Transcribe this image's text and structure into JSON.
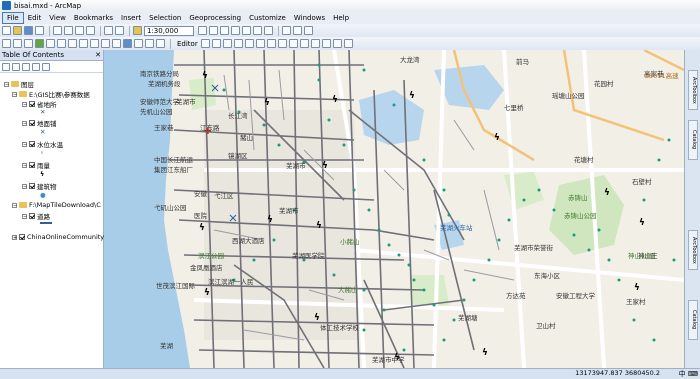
{
  "window": {
    "title": "bisai.mxd - ArcMap"
  },
  "menu": [
    "File",
    "Edit",
    "View",
    "Bookmarks",
    "Insert",
    "Selection",
    "Geoprocessing",
    "Customize",
    "Windows",
    "Help"
  ],
  "toolbar": {
    "scale": "1:30,000",
    "editor_label": "Editor"
  },
  "toc": {
    "title": "Table Of Contents",
    "layers": [
      {
        "label": "图层"
      },
      {
        "label": "E:\\GIS比赛\\参赛数据"
      },
      {
        "label": "省地所"
      },
      {
        "label": "地面铺"
      },
      {
        "label": "水位水温"
      },
      {
        "label": "雨量"
      },
      {
        "label": "建筑物"
      },
      {
        "label": "F:\\MapTileDownload\\C"
      },
      {
        "label": "道路"
      },
      {
        "label": "ChinaOnlineCommunity"
      }
    ]
  },
  "map": {
    "labels": [
      "南京铁路分局",
      "芜湖机务段",
      "安徽师范大学",
      "芜湖市",
      "先机山公园",
      "长江湾",
      "王家巷",
      "江东路",
      "镜湖区",
      "中国长江航运",
      "集团江东船厂",
      "赭山",
      "弋江区",
      "芜湖市",
      "弋矶山公园",
      "医院",
      "安徽",
      "滨江公园",
      "西湖大酒店",
      "芜湖市",
      "芜湖医学院",
      "芜湖火车站",
      "小赭山",
      "大赭山",
      "芜湖塘",
      "世茂滨江国际",
      "滨江滨湖一人民",
      "芜湖",
      "金凤凰酒店",
      "体工技术学校",
      "芜湖市中学",
      "安徽工程大学",
      "方达苑",
      "大龙湾",
      "前马",
      "花园村",
      "瑶塘山公园",
      "高家巷",
      "神山庄",
      "东海小区",
      "卫山村",
      "王家村",
      "芜湖市荣誉街",
      "赤铸山",
      "赤铸山公园",
      "神山公园",
      "花塘村",
      "石壁村",
      "G5011高速",
      "七里桥"
    ]
  },
  "status": {
    "coords": "13173947.837  3680450.2"
  }
}
